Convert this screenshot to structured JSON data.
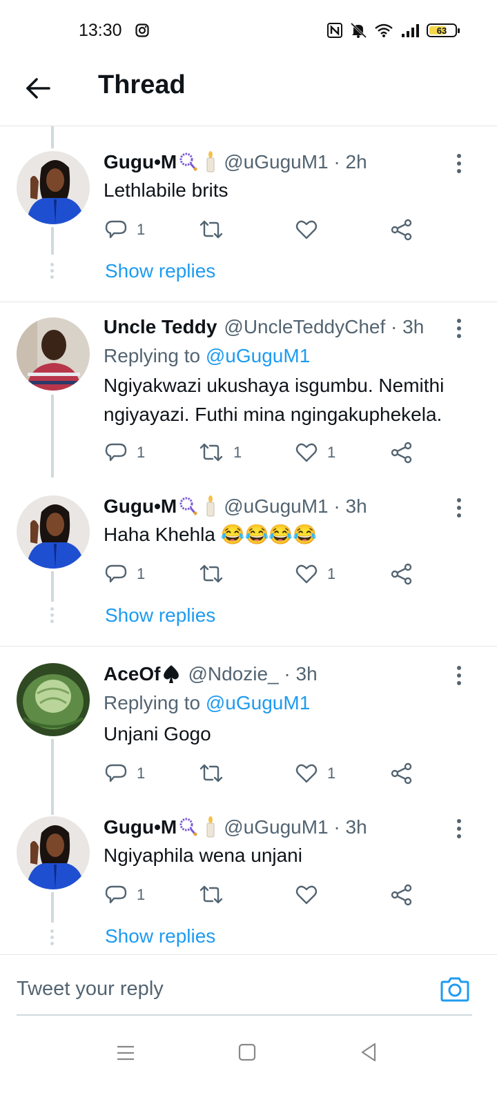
{
  "status_bar": {
    "time": "13:30",
    "battery": "63",
    "icons": [
      "instagram-icon",
      "nfc-icon",
      "mute-icon",
      "wifi-icon",
      "signal-icon",
      "battery-icon"
    ]
  },
  "header": {
    "title": "Thread"
  },
  "tweets": [
    {
      "name": "Gugu•M",
      "emojis": [
        "prayer-beads-emoji",
        "candle-emoji"
      ],
      "handle": "@uGuguM1 · 2h",
      "text": "Lethlabile brits",
      "replies": "1",
      "retweets": "",
      "likes": "",
      "show_replies": "Show replies"
    },
    {
      "name": "Uncle Teddy",
      "handle": "@UncleTeddyChef · 3h",
      "replying_prefix": "Replying to ",
      "replying_to": "@uGuguM1",
      "text": "Ngiyakwazi ukushaya isgumbu. Nemithi ngiyayazi. Futhi mina ngingakuphekela.",
      "replies": "1",
      "retweets": "1",
      "likes": "1"
    },
    {
      "name": "Gugu•M",
      "emojis": [
        "prayer-beads-emoji",
        "candle-emoji"
      ],
      "handle": "@uGuguM1 · 3h",
      "text": "Haha Khehla 😂😂😂😂",
      "replies": "1",
      "retweets": "",
      "likes": "1",
      "show_replies": "Show replies"
    },
    {
      "name": "AceOf",
      "emojis": [
        "spade-emoji"
      ],
      "handle": "@Ndozie_ · 3h",
      "replying_prefix": "Replying to ",
      "replying_to": "@uGuguM1",
      "text": "Unjani Gogo",
      "replies": "1",
      "retweets": "",
      "likes": "1"
    },
    {
      "name": "Gugu•M",
      "emojis": [
        "prayer-beads-emoji",
        "candle-emoji"
      ],
      "handle": "@uGuguM1 · 3h",
      "text": "Ngiyaphila wena unjani",
      "replies": "1",
      "retweets": "",
      "likes": "",
      "show_replies": "Show replies"
    }
  ],
  "composer": {
    "placeholder": "Tweet your reply"
  },
  "colors": {
    "accent": "#1d9bf0",
    "muted": "#536471",
    "text": "#0f1419",
    "line": "#cfd9de"
  }
}
